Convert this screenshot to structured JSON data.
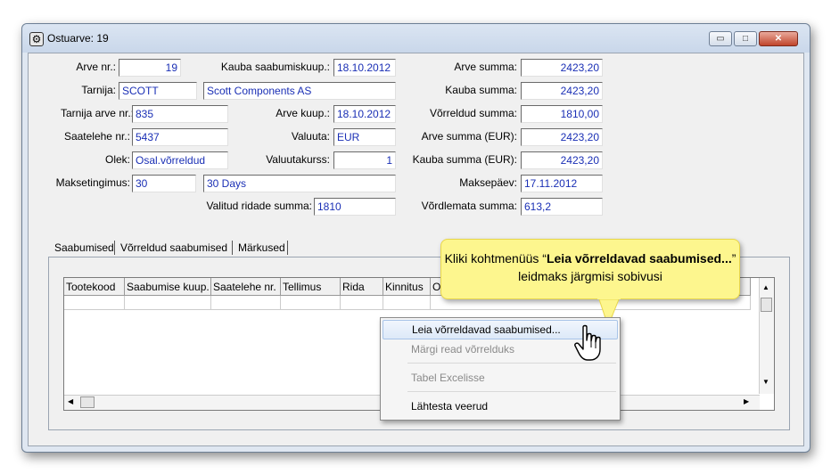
{
  "window": {
    "title": "Ostuarve: 19",
    "controls": {
      "minimize": "▭",
      "maximize": "□",
      "close": "✕"
    }
  },
  "form": {
    "arve_nr": {
      "label": "Arve nr.:",
      "value": "19"
    },
    "kauba_saabumiskuup": {
      "label": "Kauba saabumiskuup.:",
      "value": "18.10.2012"
    },
    "arve_summa": {
      "label": "Arve summa:",
      "value": "2423,20"
    },
    "tarnija": {
      "label": "Tarnija:",
      "code": "SCOTT",
      "name": "Scott Components AS"
    },
    "kauba_summa": {
      "label": "Kauba summa:",
      "value": "2423,20"
    },
    "tarnija_arve_nr": {
      "label": "Tarnija arve nr.:",
      "value": "835"
    },
    "arve_kuup": {
      "label": "Arve kuup.:",
      "value": "18.10.2012"
    },
    "vorreldud_summa": {
      "label": "Võrreldud summa:",
      "value": "1810,00"
    },
    "saatelehe_nr": {
      "label": "Saatelehe nr.:",
      "value": "5437"
    },
    "valuuta": {
      "label": "Valuuta:",
      "value": "EUR"
    },
    "arve_summa_eur": {
      "label": "Arve summa (EUR):",
      "value": "2423,20"
    },
    "olek": {
      "label": "Olek:",
      "value": "Osal.võrreldud"
    },
    "valuutakurss": {
      "label": "Valuutakurss:",
      "value": "1"
    },
    "kauba_summa_eur": {
      "label": "Kauba summa (EUR):",
      "value": "2423,20"
    },
    "maksetingimus": {
      "label": "Maksetingimus:",
      "code": "30",
      "name": "30 Days"
    },
    "maksepaev": {
      "label": "Maksepäev:",
      "value": "17.11.2012"
    },
    "valitud_ridade_summa": {
      "label": "Valitud ridade summa:",
      "value": "1810"
    },
    "vordlemata_summa": {
      "label": "Võrdlemata summa:",
      "value": "613,2"
    }
  },
  "tabs": [
    "Saabumised",
    "Võrreldud saabumised",
    "Märkused"
  ],
  "grid": {
    "columns": [
      "Tootekood",
      "Saabumise kuup.",
      "Saatelehe nr.",
      "Tellimus",
      "Rida",
      "Kinnitus",
      "O"
    ]
  },
  "context_menu": {
    "items": [
      {
        "label": "Leia võrreldavad saabumised...",
        "state": "highlighted"
      },
      {
        "label": "Märgi read võrrelduks",
        "state": "disabled"
      },
      {
        "label": "Tabel Excelisse",
        "state": "disabled"
      },
      {
        "label": "Lähtesta veerud",
        "state": "normal"
      }
    ]
  },
  "callout": {
    "text_before": "Kliki kohtmenüüs  “",
    "bold": "Leia võrreldavad saabumised...",
    "text_after": "” leidmaks järgmisi sobivusi",
    "color": "#fdf68e"
  }
}
